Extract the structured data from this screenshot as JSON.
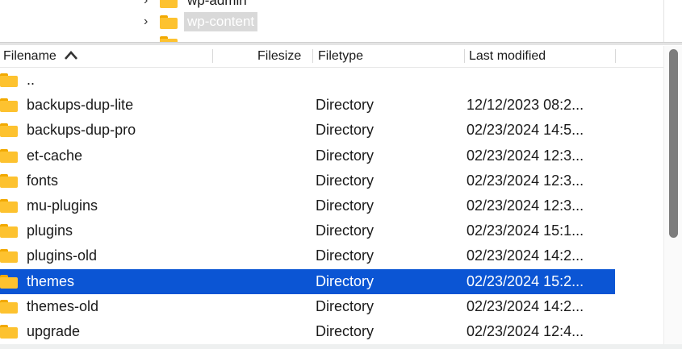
{
  "tree": {
    "items": [
      {
        "label": "wp-admin",
        "selected": false
      },
      {
        "label": "wp-content",
        "selected": true
      }
    ]
  },
  "columns": {
    "filename": "Filename",
    "sort_icon": "chevron-up-icon",
    "filesize": "Filesize",
    "filetype": "Filetype",
    "last_modified": "Last modified"
  },
  "files": [
    {
      "name": "..",
      "type": "",
      "modified": ""
    },
    {
      "name": "backups-dup-lite",
      "type": "Directory",
      "modified": "12/12/2023 08:2..."
    },
    {
      "name": "backups-dup-pro",
      "type": "Directory",
      "modified": "02/23/2024 14:5..."
    },
    {
      "name": "et-cache",
      "type": "Directory",
      "modified": "02/23/2024 12:3..."
    },
    {
      "name": "fonts",
      "type": "Directory",
      "modified": "02/23/2024 12:3..."
    },
    {
      "name": "mu-plugins",
      "type": "Directory",
      "modified": "02/23/2024 12:3..."
    },
    {
      "name": "plugins",
      "type": "Directory",
      "modified": "02/23/2024 15:1..."
    },
    {
      "name": "plugins-old",
      "type": "Directory",
      "modified": "02/23/2024 14:2..."
    },
    {
      "name": "themes",
      "type": "Directory",
      "modified": "02/23/2024 15:2...",
      "selected": true
    },
    {
      "name": "themes-old",
      "type": "Directory",
      "modified": "02/23/2024 14:2..."
    },
    {
      "name": "upgrade",
      "type": "Directory",
      "modified": "02/23/2024 12:4..."
    }
  ],
  "colors": {
    "selection": "#0b55d4",
    "folder": "#fdc22f"
  }
}
